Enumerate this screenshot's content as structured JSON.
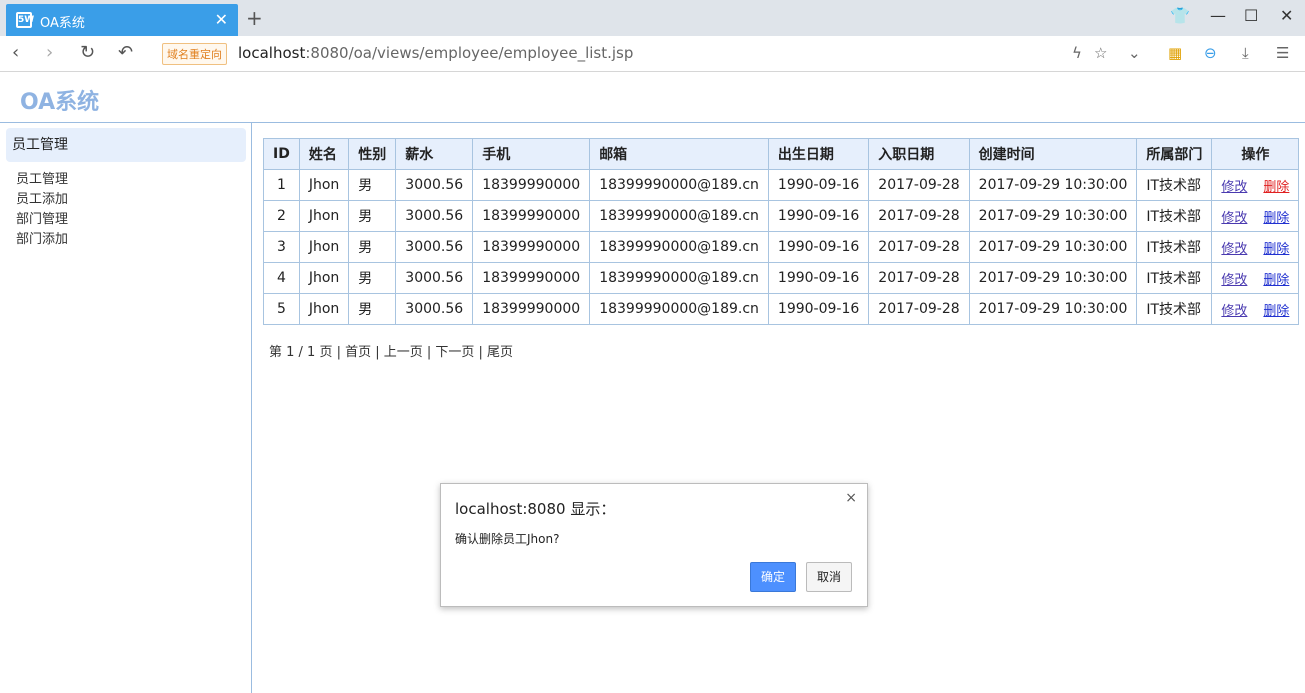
{
  "browser": {
    "tab_title": "OA系统",
    "tab_logo": "5W",
    "tab_close": "✕",
    "new_tab": "+",
    "redirect_badge": "域名重定向",
    "url_host": "localhost",
    "url_rest": ":8080/oa/views/employee/employee_list.jsp"
  },
  "app": {
    "title": "OA系统"
  },
  "sidebar": {
    "header": "员工管理",
    "links": [
      "员工管理",
      "员工添加",
      "部门管理",
      "部门添加"
    ]
  },
  "table": {
    "headers": [
      "ID",
      "姓名",
      "性别",
      "薪水",
      "手机",
      "邮箱",
      "出生日期",
      "入职日期",
      "创建时间",
      "所属部门",
      "操作"
    ],
    "rows": [
      [
        "1",
        "Jhon",
        "男",
        "3000.56",
        "18399990000",
        "18399990000@189.cn",
        "1990-09-16",
        "2017-09-28",
        "2017-09-29 10:30:00",
        "IT技术部"
      ],
      [
        "2",
        "Jhon",
        "男",
        "3000.56",
        "18399990000",
        "18399990000@189.cn",
        "1990-09-16",
        "2017-09-28",
        "2017-09-29 10:30:00",
        "IT技术部"
      ],
      [
        "3",
        "Jhon",
        "男",
        "3000.56",
        "18399990000",
        "18399990000@189.cn",
        "1990-09-16",
        "2017-09-28",
        "2017-09-29 10:30:00",
        "IT技术部"
      ],
      [
        "4",
        "Jhon",
        "男",
        "3000.56",
        "18399990000",
        "18399990000@189.cn",
        "1990-09-16",
        "2017-09-28",
        "2017-09-29 10:30:00",
        "IT技术部"
      ],
      [
        "5",
        "Jhon",
        "男",
        "3000.56",
        "18399990000",
        "18399990000@189.cn",
        "1990-09-16",
        "2017-09-28",
        "2017-09-29 10:30:00",
        "IT技术部"
      ]
    ],
    "edit_label": "修改",
    "delete_label": "删除"
  },
  "pager": {
    "text": "第 1 / 1 页 | 首页 | 上一页 | 下一页 | 尾页"
  },
  "dialog": {
    "title": "localhost:8080 显示：",
    "message": "确认删除员工Jhon?",
    "ok": "确定",
    "cancel": "取消",
    "close": "×"
  }
}
